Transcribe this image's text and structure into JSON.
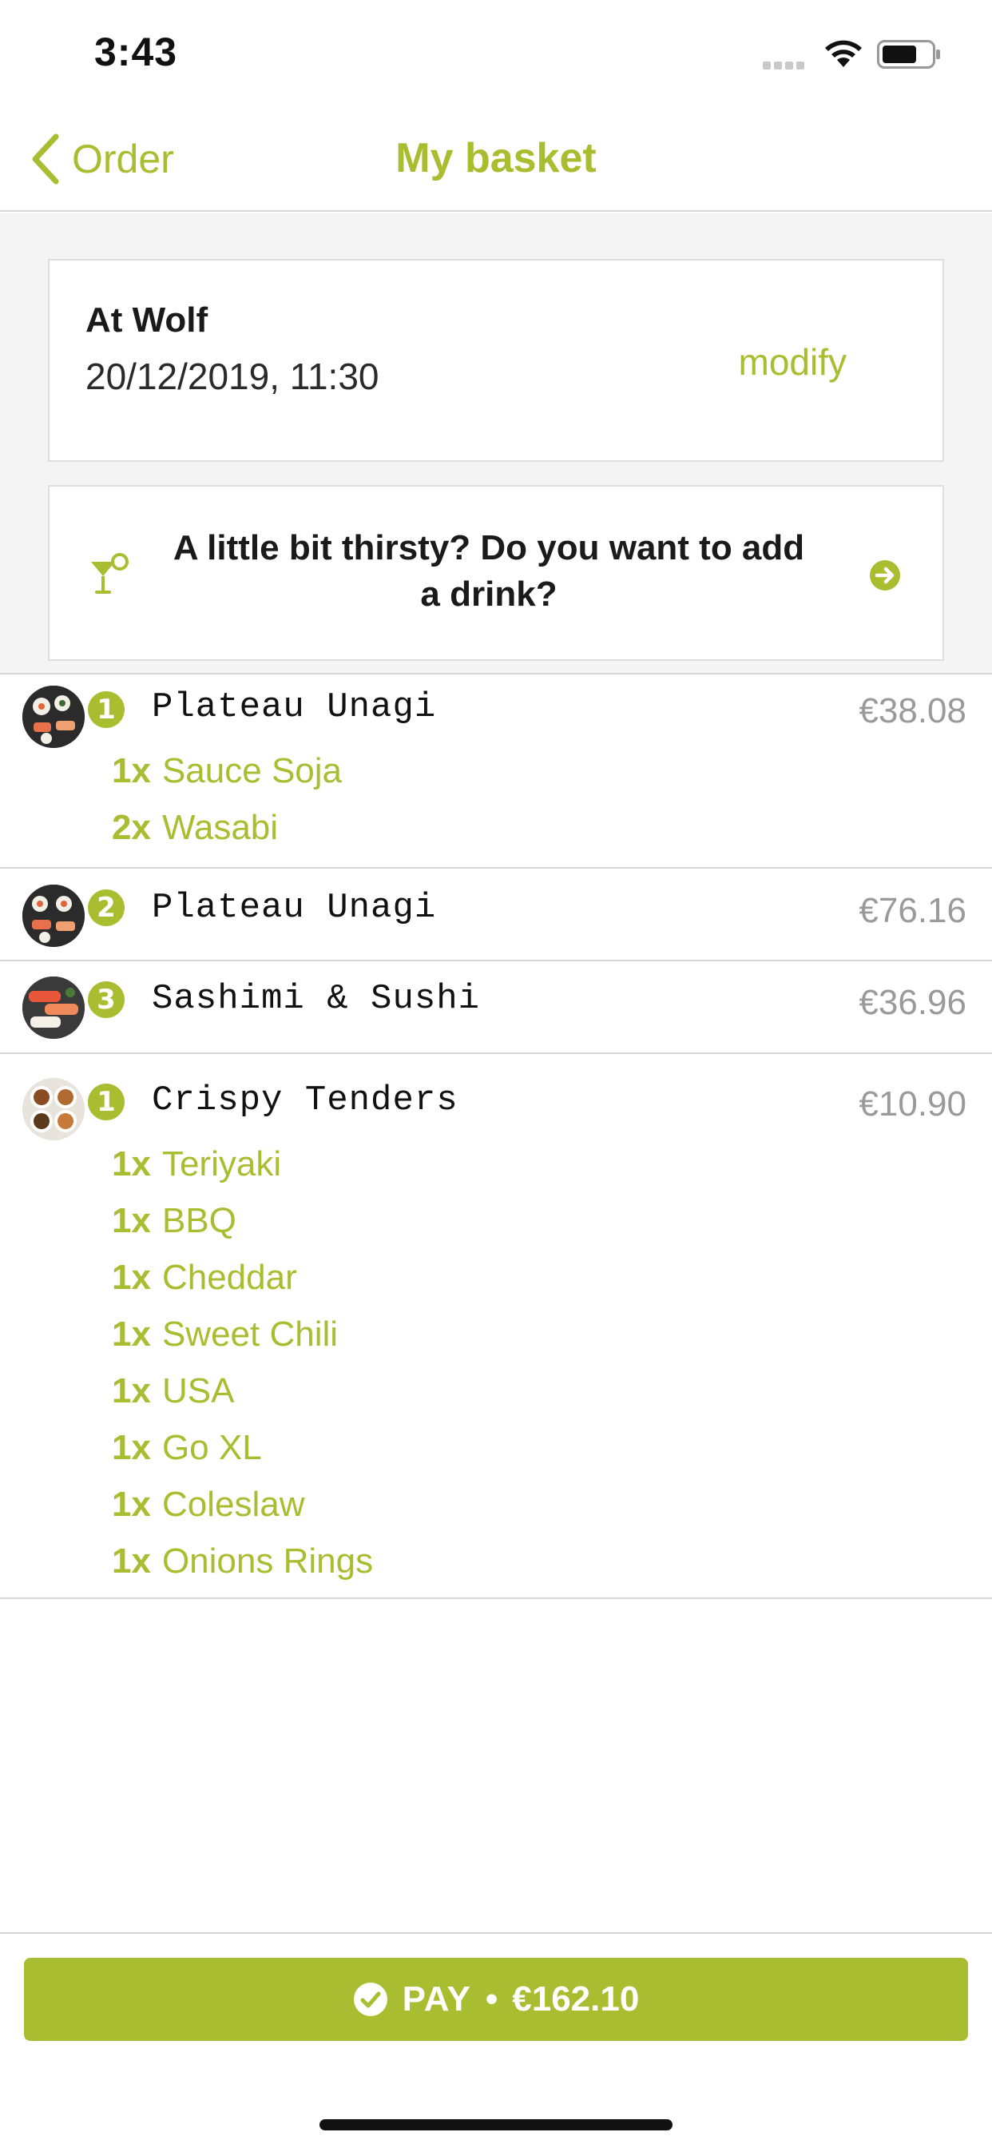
{
  "status": {
    "time": "3:43"
  },
  "nav": {
    "back_label": "Order",
    "title": "My basket"
  },
  "pickup": {
    "name": "At Wolf",
    "datetime": "20/12/2019, 11:30",
    "modify_label": "modify"
  },
  "drink_prompt": {
    "text": "A little bit thirsty? Do you want to add a drink?"
  },
  "basket": {
    "items": [
      {
        "qty": "1",
        "name": "Plateau Unagi",
        "price": "€38.08",
        "extras": [
          {
            "qty": "1x",
            "name": "Sauce Soja"
          },
          {
            "qty": "2x",
            "name": "Wasabi"
          }
        ]
      },
      {
        "qty": "2",
        "name": "Plateau Unagi",
        "price": "€76.16",
        "extras": []
      },
      {
        "qty": "3",
        "name": "Sashimi & Sushi",
        "price": "€36.96",
        "extras": []
      },
      {
        "qty": "1",
        "name": "Crispy Tenders",
        "price": "€10.90",
        "extras": [
          {
            "qty": "1x",
            "name": "Teriyaki"
          },
          {
            "qty": "1x",
            "name": "BBQ"
          },
          {
            "qty": "1x",
            "name": "Cheddar"
          },
          {
            "qty": "1x",
            "name": "Sweet Chili"
          },
          {
            "qty": "1x",
            "name": "USA"
          },
          {
            "qty": "1x",
            "name": "Go XL"
          },
          {
            "qty": "1x",
            "name": "Coleslaw"
          },
          {
            "qty": "1x",
            "name": "Onions Rings"
          }
        ]
      }
    ]
  },
  "pay": {
    "label": "PAY",
    "separator": "•",
    "total": "€162.10"
  },
  "colors": {
    "accent": "#a8bd30",
    "price_gray": "#9a9a9a",
    "divider": "#d6d6d6",
    "background_gray": "#f4f4f4"
  },
  "icons": {
    "back": "chevron-left-icon",
    "drink": "cocktail-icon",
    "arrow": "arrow-right-circle-icon",
    "pay": "check-circle-icon"
  }
}
